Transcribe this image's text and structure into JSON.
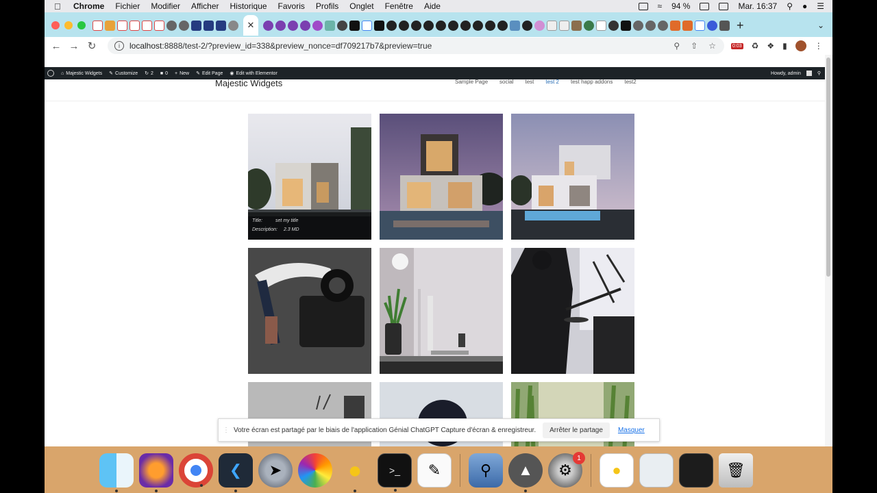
{
  "menubar": {
    "app": "Chrome",
    "items": [
      "Fichier",
      "Modifier",
      "Afficher",
      "Historique",
      "Favoris",
      "Profils",
      "Onglet",
      "Fenêtre",
      "Aide"
    ],
    "battery": "94 %",
    "clock": "Mar. 16:37"
  },
  "browser": {
    "url_host": "localhost",
    "url_rest": ":8888/test-2/?preview_id=338&preview_nonce=df709217b7&preview=true",
    "ext_badge": "0:03"
  },
  "wp_admin_bar": {
    "site": "Majestic Widgets",
    "customize": "Customize",
    "updates": "2",
    "comments": "0",
    "new": "New",
    "edit_page": "Edit Page",
    "elementor": "Edit with Elementor",
    "howdy": "Howdy, admin"
  },
  "site": {
    "title": "Majestic Widgets",
    "nav": [
      "Sample Page",
      "social",
      "test",
      "test 2",
      "test happ addons",
      "test2"
    ],
    "current_nav": "test 2"
  },
  "gallery": {
    "caption": {
      "title_label": "Title:",
      "title_value": "set my title",
      "desc_label": "Description:",
      "desc_value": "2.3 MD"
    }
  },
  "share_banner": {
    "message": "Votre écran est partagé par le biais de l'application Génial ChatGPT Capture d'écran & enregistreur.",
    "stop": "Arrêter le partage",
    "hide": "Masquer"
  },
  "dock": {
    "items": [
      "finder-icon",
      "firefox-icon",
      "chrome-icon",
      "vscode-icon",
      "launchpad-icon",
      "photos-icon",
      "cyberduck-icon",
      "terminal-icon",
      "textedit-icon",
      "preview-icon",
      "mamp-icon",
      "system-preferences-icon",
      "document-icon",
      "screenshot-icon",
      "window-icon",
      "trash-icon"
    ],
    "settings_badge": "1"
  }
}
